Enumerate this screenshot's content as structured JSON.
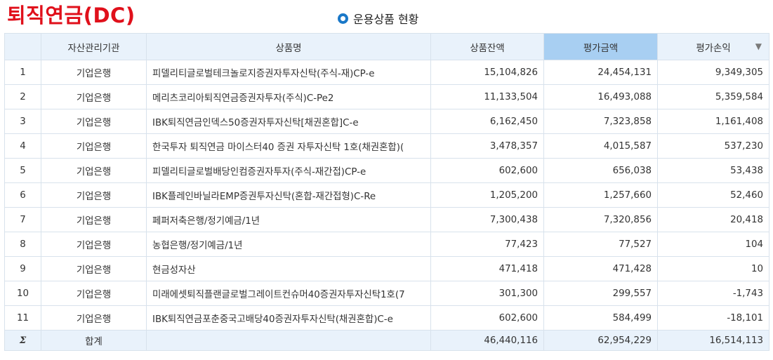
{
  "header": {
    "title": "퇴직연금(DC)",
    "section_title": "운용상품 현황"
  },
  "table": {
    "columns": {
      "no": "",
      "org": "자산관리기관",
      "name": "상품명",
      "balance": "상품잔액",
      "eval": "평가금액",
      "pnl": "평가손익"
    },
    "sorted_column": "평가손익",
    "rows": [
      {
        "no": "1",
        "org": "기업은행",
        "name": "피델리티글로벌테크놀로지증권자투자신탁(주식-재)CP-e",
        "balance": "15,104,826",
        "eval": "24,454,131",
        "pnl": "9,349,305"
      },
      {
        "no": "2",
        "org": "기업은행",
        "name": "메리츠코리아퇴직연금증권자투자(주식)C-Pe2",
        "balance": "11,133,504",
        "eval": "16,493,088",
        "pnl": "5,359,584"
      },
      {
        "no": "3",
        "org": "기업은행",
        "name": "IBK퇴직연금인덱스50증권자투자신탁[채권혼합]C-e",
        "balance": "6,162,450",
        "eval": "7,323,858",
        "pnl": "1,161,408"
      },
      {
        "no": "4",
        "org": "기업은행",
        "name": "한국투자 퇴직연금 마이스터40 증권 자투자신탁 1호(채권혼합)(",
        "balance": "3,478,357",
        "eval": "4,015,587",
        "pnl": "537,230"
      },
      {
        "no": "5",
        "org": "기업은행",
        "name": "피델리티글로벌배당인컴증권자투자(주식-재간접)CP-e",
        "balance": "602,600",
        "eval": "656,038",
        "pnl": "53,438"
      },
      {
        "no": "6",
        "org": "기업은행",
        "name": "IBK플레인바닐라EMP증권투자신탁(혼합-재간접형)C-Re",
        "balance": "1,205,200",
        "eval": "1,257,660",
        "pnl": "52,460"
      },
      {
        "no": "7",
        "org": "기업은행",
        "name": "페퍼저축은행/정기예금/1년",
        "balance": "7,300,438",
        "eval": "7,320,856",
        "pnl": "20,418"
      },
      {
        "no": "8",
        "org": "기업은행",
        "name": "농협은행/정기예금/1년",
        "balance": "77,423",
        "eval": "77,527",
        "pnl": "104"
      },
      {
        "no": "9",
        "org": "기업은행",
        "name": "현금성자산",
        "balance": "471,418",
        "eval": "471,428",
        "pnl": "10"
      },
      {
        "no": "10",
        "org": "기업은행",
        "name": "미래에셋퇴직플랜글로벌그레이트컨슈머40증권자투자신탁1호(7",
        "balance": "301,300",
        "eval": "299,557",
        "pnl": "-1,743"
      },
      {
        "no": "11",
        "org": "기업은행",
        "name": "IBK퇴직연금포춘중국고배당40증권자투자신탁(채권혼합)C-e",
        "balance": "602,600",
        "eval": "584,499",
        "pnl": "-18,101"
      }
    ],
    "total": {
      "symbol": "Σ",
      "label": "합계",
      "name": "",
      "balance": "46,440,116",
      "eval": "62,954,229",
      "pnl": "16,514,113"
    }
  },
  "icons": {
    "section_bullet": "circle-bullet-icon",
    "sort": "sort-descending-icon"
  },
  "colors": {
    "title": "#e0101b",
    "accent": "#1a78c8",
    "header_bg": "#e9f2fb",
    "active_header_bg": "#a8cff2"
  }
}
